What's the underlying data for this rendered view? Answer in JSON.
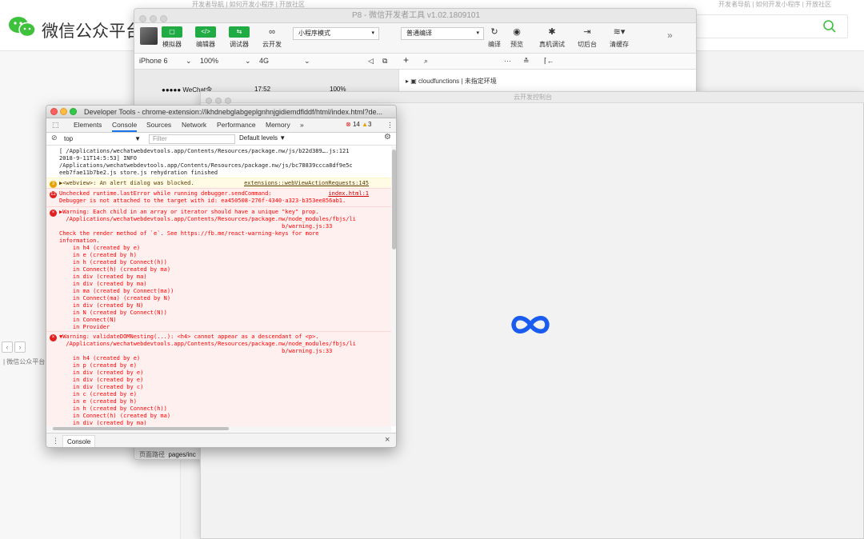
{
  "background": {
    "brand": "微信公众平台",
    "crumb": "| 微信公众平台",
    "topstrip_left": "开发者导航 | 如何开发小程序 | 开放社区",
    "topstrip_right": "开发者导航 | 如何开发小程序 | 开放社区"
  },
  "devtools_window": {
    "title": "P8 - 微信开发者工具 v1.02.1809101",
    "toolbar": {
      "simulator": "模拟器",
      "editor": "编辑器",
      "debugger": "调试器",
      "cloud": "云开发",
      "mode": "小程序模式",
      "compile_mode": "普通编译",
      "compile": "编译",
      "preview": "预览",
      "real_debug": "真机调试",
      "background": "切后台",
      "clear_cache": "清缓存"
    },
    "device": "iPhone 6",
    "zoom": "100%",
    "network": "4G",
    "phone_status": "●●●●● WeChat令",
    "phone_time": "17:52",
    "phone_battery": "100%",
    "tree_item": "cloudfunctions | 未指定环境",
    "page_path_label": "页面路径",
    "page_path_value": "pages/inc"
  },
  "cloud_console": {
    "title": "云开发控制台"
  },
  "chrome_devtools": {
    "title": "Developer Tools - chrome-extension://lkhdnebglabgeplgnhnjgidiemdflddf/html/index.html?de...",
    "tabs": [
      "Elements",
      "Console",
      "Sources",
      "Network",
      "Performance",
      "Memory",
      "»"
    ],
    "active_tab": "Console",
    "error_count": "14",
    "warning_count": "3",
    "context": "top",
    "filter_placeholder": "Filter",
    "levels": "Default levels ▼",
    "drawer_tab": "Console",
    "messages": [
      {
        "type": "info",
        "text": "[ /Applications/wechatwebdevtools.app/Contents/Resources/package.nw/js/b22d389….js:121\n2018-9-11T14:5:53] INFO\n/Applications/wechatwebdevtools.app/Contents/Resources/package.nw/js/bc78839ccca8df9e5c\neeb7fae11b7be2.js store.js rehydration finished",
        "source": ""
      },
      {
        "type": "warn",
        "badge": "3",
        "text": "▶<webview>: An alert dialog was blocked.",
        "source": "extensions::webViewActionRequests:145"
      },
      {
        "type": "err",
        "badge": "12",
        "text": "Unchecked runtime.lastError while running debugger.sendCommand:\nDebugger is not attached to the target with id: ea450508-276f-4340-a323-b353ee856ab1.",
        "source": "index.html:1"
      },
      {
        "type": "err",
        "badge": "x",
        "text": "▶Warning: Each child in an array or iterator should have a unique \"key\" prop.\n  /Applications/wechatwebdevtools.app/Contents/Resources/package.nw/node_modules/fbjs/li\n                                                                  b/warning.js:33\nCheck the render method of `e`. See https://fb.me/react-warning-keys for more\ninformation.\n    in h4 (created by e)\n    in e (created by h)\n    in h (created by Connect(h))\n    in Connect(h) (created by ma)\n    in div (created by ma)\n    in div (created by ma)\n    in ma (created by Connect(ma))\n    in Connect(ma) (created by N)\n    in div (created by N)\n    in N (created by Connect(N))\n    in Connect(N)\n    in Provider",
        "source": ""
      },
      {
        "type": "err",
        "badge": "x",
        "text": "▼Warning: validateDOMNesting(...): <h4> cannot appear as a descendant of <p>.\n  /Applications/wechatwebdevtools.app/Contents/Resources/package.nw/node_modules/fbjs/li\n                                                                  b/warning.js:33\n    in h4 (created by e)\n    in p (created by e)\n    in div (created by e)\n    in div (created by e)\n    in div (created by c)\n    in c (created by e)\n    in e (created by h)\n    in h (created by Connect(h))\n    in Connect(h) (created by ma)\n    in div (created by ma)",
        "source": ""
      }
    ]
  }
}
